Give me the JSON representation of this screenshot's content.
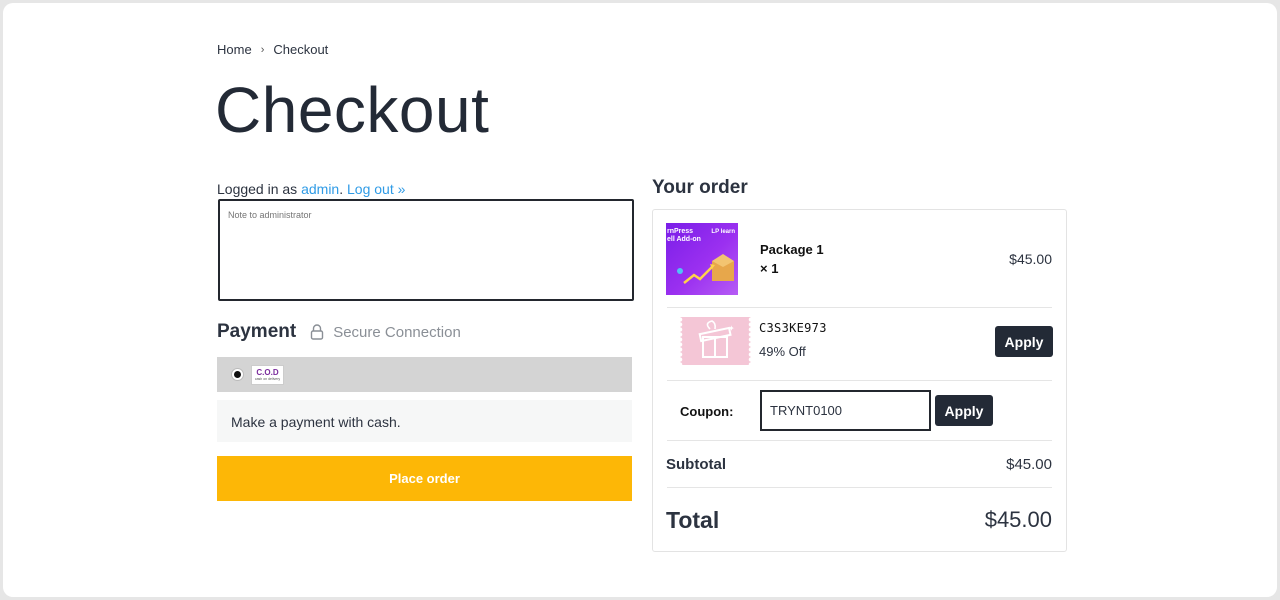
{
  "breadcrumb": {
    "home": "Home",
    "separator": "›",
    "current": "Checkout"
  },
  "page": {
    "title": "Checkout"
  },
  "account": {
    "prefix": "Logged in as ",
    "username": "admin",
    "period": ".",
    "logout": "Log out »"
  },
  "note": {
    "placeholder": "Note to administrator"
  },
  "payment": {
    "title": "Payment",
    "lock_icon": "lock-icon",
    "secure_label": "Secure Connection",
    "method": {
      "logo_text": "C.O.D",
      "logo_sub": "cash on delivery",
      "selected": true
    },
    "description": "Make a payment with cash."
  },
  "place_order_label": "Place order",
  "order": {
    "title": "Your order",
    "item": {
      "thumb_text": "rnPress\nell Add-on",
      "thumb_brand": "LP learn",
      "name": "Package 1",
      "qty": "× 1",
      "price": "$45.00"
    },
    "suggested_coupon": {
      "code": "C3S3KE973",
      "discount": "49% Off",
      "apply_label": "Apply",
      "icon": "gift-icon"
    },
    "coupon": {
      "label": "Coupon:",
      "value": "TRYNT0100",
      "apply_label": "Apply"
    },
    "subtotal": {
      "label": "Subtotal",
      "value": "$45.00"
    },
    "total": {
      "label": "Total",
      "value": "$45.00"
    }
  },
  "colors": {
    "accent_link": "#2f9be6",
    "place_order": "#fdb706",
    "dark_button": "#232a36",
    "coupon_bg": "#f4c6d6"
  }
}
